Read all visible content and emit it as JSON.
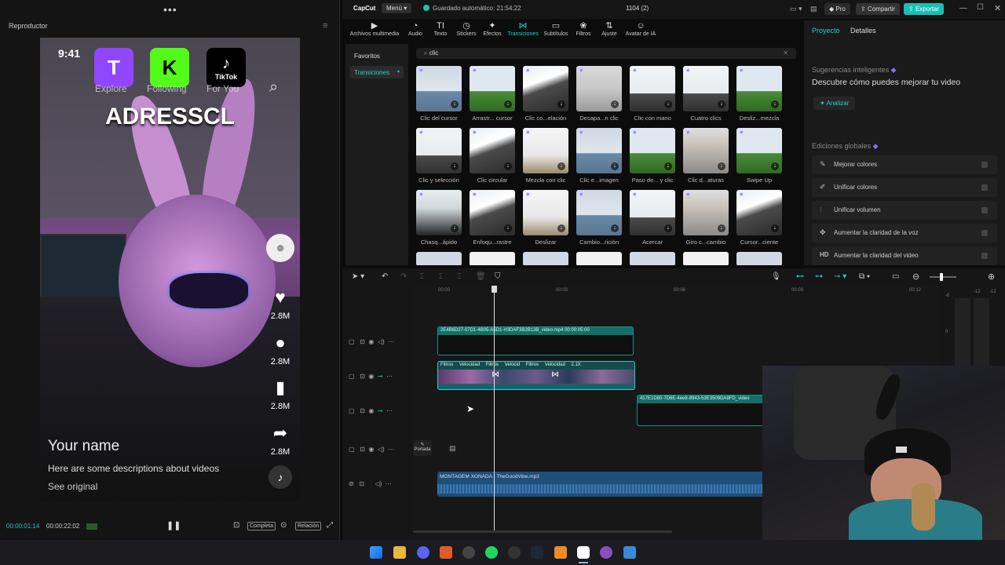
{
  "player": {
    "title": "Reproductor",
    "dots": "•••",
    "menu_icon": "≡",
    "video": {
      "clock": "9:41",
      "apps": [
        {
          "name": "twitch",
          "glyph": "T",
          "bg": "#9146ff",
          "fg": "#fff"
        },
        {
          "name": "kick",
          "glyph": "K",
          "bg": "#53fc18",
          "fg": "#000"
        },
        {
          "name": "tiktok",
          "glyph": "♪",
          "bg": "#000",
          "fg": "#fff",
          "caption": "TikTok"
        }
      ],
      "tabs": [
        "Explore",
        "Following",
        "For You"
      ],
      "overlay_title": "ADRESSCL",
      "counts": [
        "2.8M",
        "2.8M",
        "2.8M",
        "2.8M"
      ],
      "name": "Your name",
      "description": "Here are some descriptions about videos",
      "see_original": "See original"
    },
    "controls": {
      "current_time": "00:00:01:14",
      "total_time": "00:00:22:02",
      "full_label": "Completa",
      "ratio_label": "Relación"
    }
  },
  "topbar": {
    "logo": "CapCut",
    "menu": "Menú",
    "autosave": "Guardado automático: 21:54:22",
    "project_name": "1104 (2)",
    "pro": "Pro",
    "share": "Compartir",
    "export": "Exportar"
  },
  "toolbar": {
    "tools": [
      {
        "label": "Archivos multimedia",
        "icon": "▶"
      },
      {
        "label": "Audio",
        "icon": "◔"
      },
      {
        "label": "Texto",
        "icon": "TI"
      },
      {
        "label": "Stickers",
        "icon": "◷"
      },
      {
        "label": "Efectos",
        "icon": "✦"
      },
      {
        "label": "Transiciones",
        "icon": "⋈",
        "active": true
      },
      {
        "label": "Subtítulos",
        "icon": "▭"
      },
      {
        "label": "Filtros",
        "icon": "❀"
      },
      {
        "label": "Ajuste",
        "icon": "⇅"
      },
      {
        "label": "Avatar de IA",
        "icon": "☺"
      }
    ]
  },
  "leftnav": {
    "favorites": "Favoritos",
    "transitions": "Transiciones"
  },
  "search": {
    "value": "clic"
  },
  "transitions": [
    {
      "label": "Clic del cursor",
      "scene": "tower"
    },
    {
      "label": "Arrastr... cursor",
      "scene": "grass"
    },
    {
      "label": "Clic co...elación",
      "scene": "mountain"
    },
    {
      "label": "Desapa...n clic",
      "scene": "car"
    },
    {
      "label": "Clic con mano",
      "scene": "city"
    },
    {
      "label": "Cuatro clics",
      "scene": "city"
    },
    {
      "label": "Desliz...mezcla",
      "scene": "grass"
    },
    {
      "label": "Clic y selección",
      "scene": "city"
    },
    {
      "label": "Clic circular",
      "scene": "mountain"
    },
    {
      "label": "Mezcla con clic",
      "scene": "windmill"
    },
    {
      "label": "Clic e...imagen",
      "scene": "tower"
    },
    {
      "label": "Paso de... y clic",
      "scene": "grass"
    },
    {
      "label": "Clic d...aturas",
      "scene": "person"
    },
    {
      "label": "Swipe Up",
      "scene": "grass"
    },
    {
      "label": "Chasq...ápido",
      "scene": "person2"
    },
    {
      "label": "Enfoqu...rastre",
      "scene": "mountain"
    },
    {
      "label": "Deslizar",
      "scene": "windmill"
    },
    {
      "label": "Cambio...rición",
      "scene": "tower"
    },
    {
      "label": "Acercar",
      "scene": "city"
    },
    {
      "label": "Giro c...cambio",
      "scene": "person"
    },
    {
      "label": "Cursor...ciente",
      "scene": "mountain"
    }
  ],
  "rpanel": {
    "tab_project": "Proyecto",
    "tab_details": "Detalles",
    "suggest_title": "Sugerencias inteligentes",
    "suggest_body": "Descubre cómo puedes mejorar tu video",
    "analyze": "Analizar",
    "global_title": "Ediciones globales",
    "global_items": [
      {
        "label": "Mejorar colores",
        "icon": "✎"
      },
      {
        "label": "Unificar colores",
        "icon": "✐"
      },
      {
        "label": "Unificar volumen",
        "icon": "⫶"
      },
      {
        "label": "Aumentar la claridad de la voz",
        "icon": "✥"
      },
      {
        "label": "Aumentar la claridad del video",
        "icon": "HD"
      }
    ]
  },
  "timeline": {
    "ruler": [
      "00:00",
      "00:03",
      "00:06",
      "00:09",
      "00:12"
    ],
    "db": [
      "-6",
      "-12",
      "0",
      "-12"
    ],
    "clip1": "2E4B6D27-07D1-4B05-A5D1-H3DAF3B2B13B_video.mp4   00:00:05:00",
    "clip2_segments": [
      "Filtros",
      "Velocidad",
      "Filtros",
      "Velocid",
      "Filtros",
      "Velocidad 2.1X"
    ],
    "clip3": "417E1D80-7D6E-4ee8-8943-53E3509DA9FD_video",
    "cover": "Portada",
    "audio": "MONTAGEM XONADA - TheGoodVibe.mp3"
  }
}
